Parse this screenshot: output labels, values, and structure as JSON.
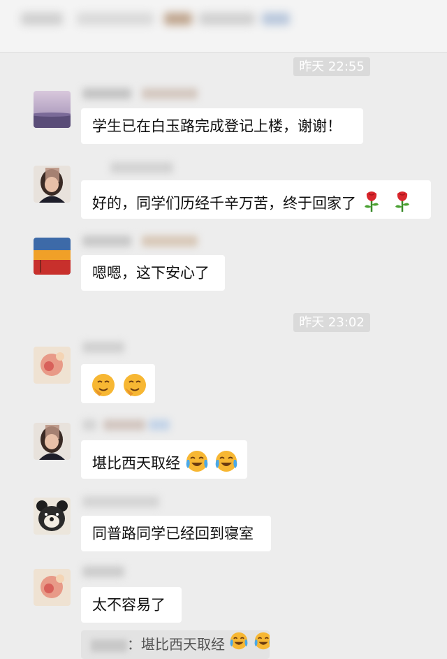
{
  "timestamps": [
    "昨天 22:55",
    "昨天 23:02"
  ],
  "messages": [
    {
      "text": "学生已在白玉路完成登记上楼，谢谢！",
      "avatar": "landscape-avatar",
      "emoji": []
    },
    {
      "text": "好的，同学们历经千辛万苦，终于回家了",
      "avatar": "woman-avatar",
      "emoji": [
        "rose-icon",
        "rose-icon"
      ]
    },
    {
      "text": "嗯嗯，这下安心了",
      "avatar": "sunset-avatar",
      "emoji": []
    },
    {
      "text": "",
      "avatar": "pink-avatar",
      "emoji": [
        "salute-face-icon",
        "salute-face-icon"
      ]
    },
    {
      "text": "堪比西天取经",
      "avatar": "woman-avatar",
      "emoji": [
        "crying-laughing-icon",
        "crying-laughing-icon"
      ]
    },
    {
      "text": "同普路同学已经回到寝室",
      "avatar": "bear-avatar",
      "emoji": []
    },
    {
      "text": "太不容易了",
      "avatar": "pink-avatar",
      "emoji": []
    }
  ],
  "quote": {
    "separator": "：",
    "text": "堪比西天取经",
    "emoji": [
      "crying-laughing-icon",
      "crying-laughing-icon"
    ]
  },
  "colors": {
    "background": "#ededed",
    "bubble": "#ffffff",
    "timestamp_bg": "#dadada",
    "rose": "#d9262c",
    "emoji_face": "#f7b733"
  }
}
